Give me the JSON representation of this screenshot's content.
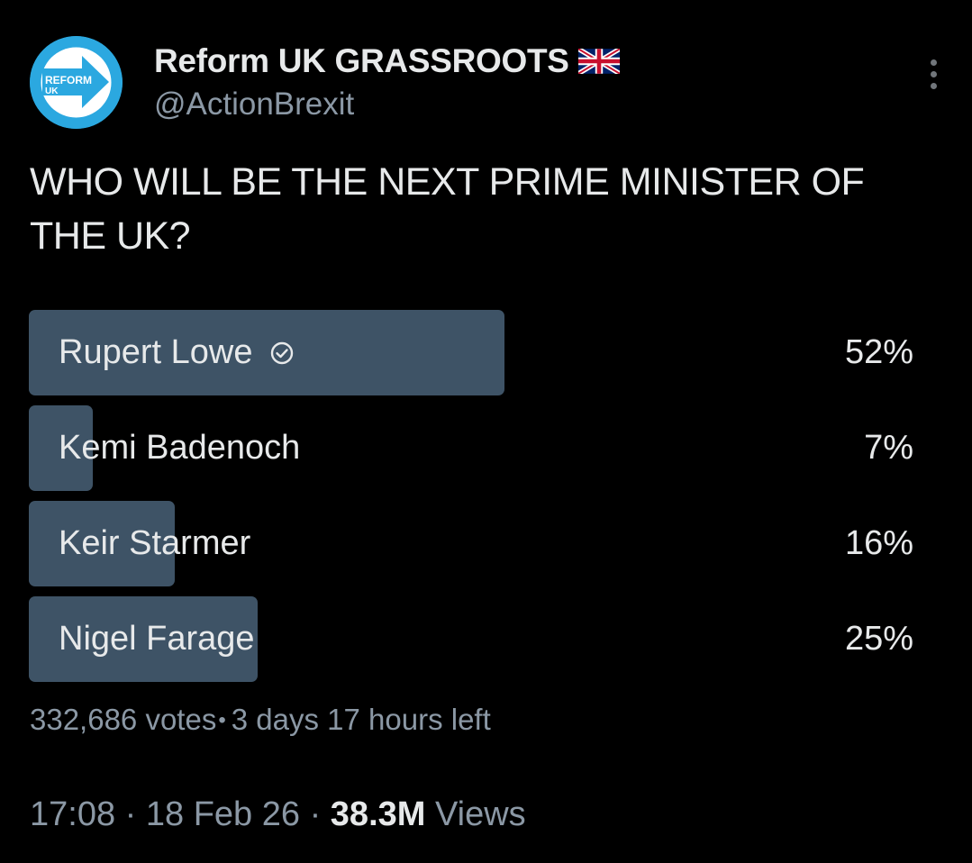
{
  "account": {
    "display_name": "Reform UK GRASSROOTS",
    "handle": "@ActionBrexit",
    "avatar_text_line1": "REFORM",
    "avatar_text_line2": "UK",
    "flag_icon": "uk-flag-icon"
  },
  "post": {
    "text": "WHO WILL BE THE NEXT PRIME MINISTER OF THE UK?"
  },
  "poll": {
    "options": [
      {
        "label": "Rupert Lowe",
        "percent_label": "52%",
        "percent": 52,
        "selected": true
      },
      {
        "label": "Kemi Badenoch",
        "percent_label": "7%",
        "percent": 7,
        "selected": false
      },
      {
        "label": "Keir Starmer",
        "percent_label": "16%",
        "percent": 16,
        "selected": false
      },
      {
        "label": "Nigel Farage",
        "percent_label": "25%",
        "percent": 25,
        "selected": false
      }
    ],
    "votes": "332,686 votes",
    "separator": "•",
    "time_left": "3 days 17 hours left"
  },
  "meta": {
    "time": "17:08",
    "date": "18 Feb 26",
    "dot": "·",
    "views_count": "38.3M",
    "views_label": "Views"
  },
  "colors": {
    "background": "#000000",
    "poll_bar": "#3e5366",
    "text_primary": "#e7e9ea",
    "text_secondary": "#8b98a5",
    "avatar": "#2ba8e0"
  }
}
